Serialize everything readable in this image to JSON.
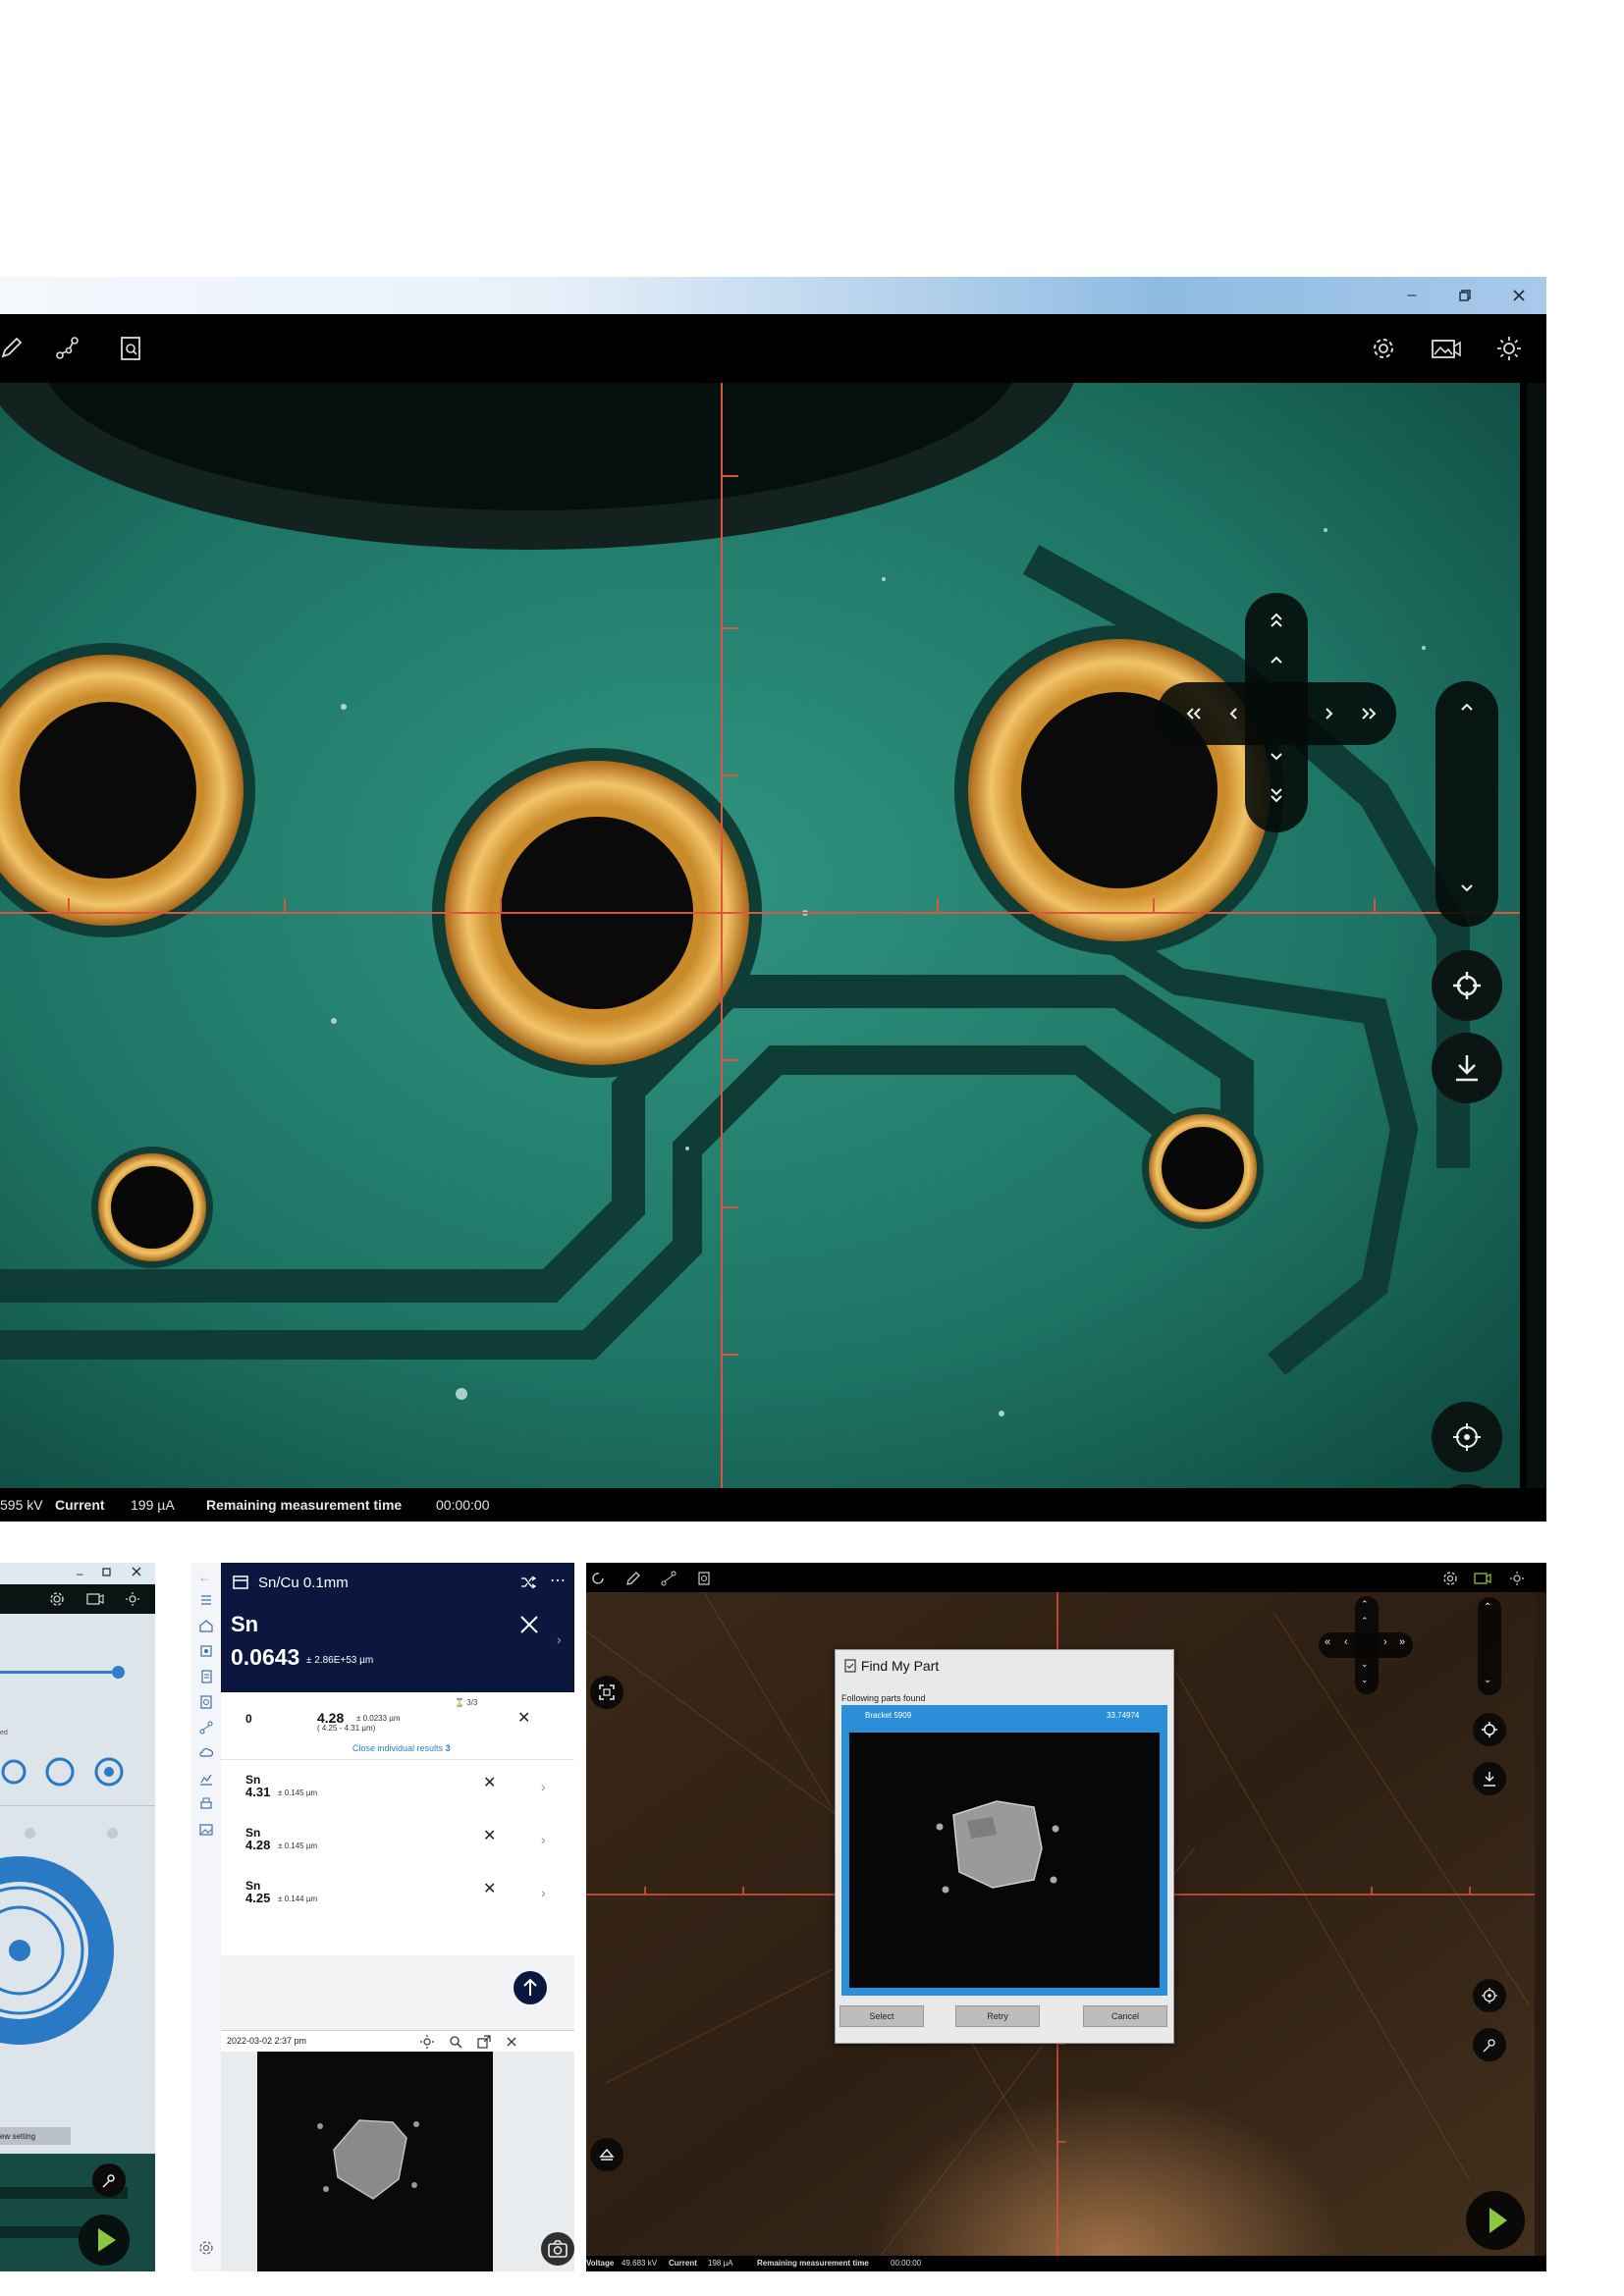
{
  "top_window": {
    "status": {
      "voltage_value": "595 kV",
      "current_label": "Current",
      "current_value": "199 µA",
      "remaining_label": "Remaining measurement time",
      "remaining_value": "00:00:00"
    }
  },
  "bottom_left_window": {
    "view_setting_label": "ew setting",
    "side_label": "ed"
  },
  "measurement_app": {
    "title": "Sn/Cu 0.1mm",
    "result": {
      "element": "Sn",
      "value": "0.0643",
      "uncertainty": "± 2.86E+53 µm"
    },
    "summary": {
      "index": "0",
      "value": "4.28",
      "uncertainty": "± 0.0233 µm",
      "range": "( 4.25 - 4.31 µm)",
      "count": "3/3",
      "close_link": "Close individual results",
      "close_count": "3"
    },
    "readings": [
      {
        "element": "Sn",
        "value": "4.31",
        "uncertainty": "± 0.145 µm"
      },
      {
        "element": "Sn",
        "value": "4.28",
        "uncertainty": "± 0.145 µm"
      },
      {
        "element": "Sn",
        "value": "4.25",
        "uncertainty": "± 0.144 µm"
      }
    ],
    "image_timestamp": "2022-03-02 2:37 pm"
  },
  "find_my_part": {
    "title": "Find My Part",
    "subtitle": "Following parts found",
    "match_name": "Bracket 5909",
    "match_score": "33.74974",
    "buttons": {
      "select": "Select",
      "retry": "Retry",
      "cancel": "Cancel"
    }
  },
  "bottom_right_window": {
    "status": {
      "voltage_label": "Voltage",
      "voltage_value": "49.683 kV",
      "current_label": "Current",
      "current_value": "198 µA",
      "remaining_label": "Remaining measurement time",
      "remaining_value": "00:00:00"
    }
  },
  "colors": {
    "accent_green": "#8dc63f",
    "navy": "#0c1740",
    "crosshair": "#e0543a",
    "dialog_blue": "#2a8fd8"
  }
}
